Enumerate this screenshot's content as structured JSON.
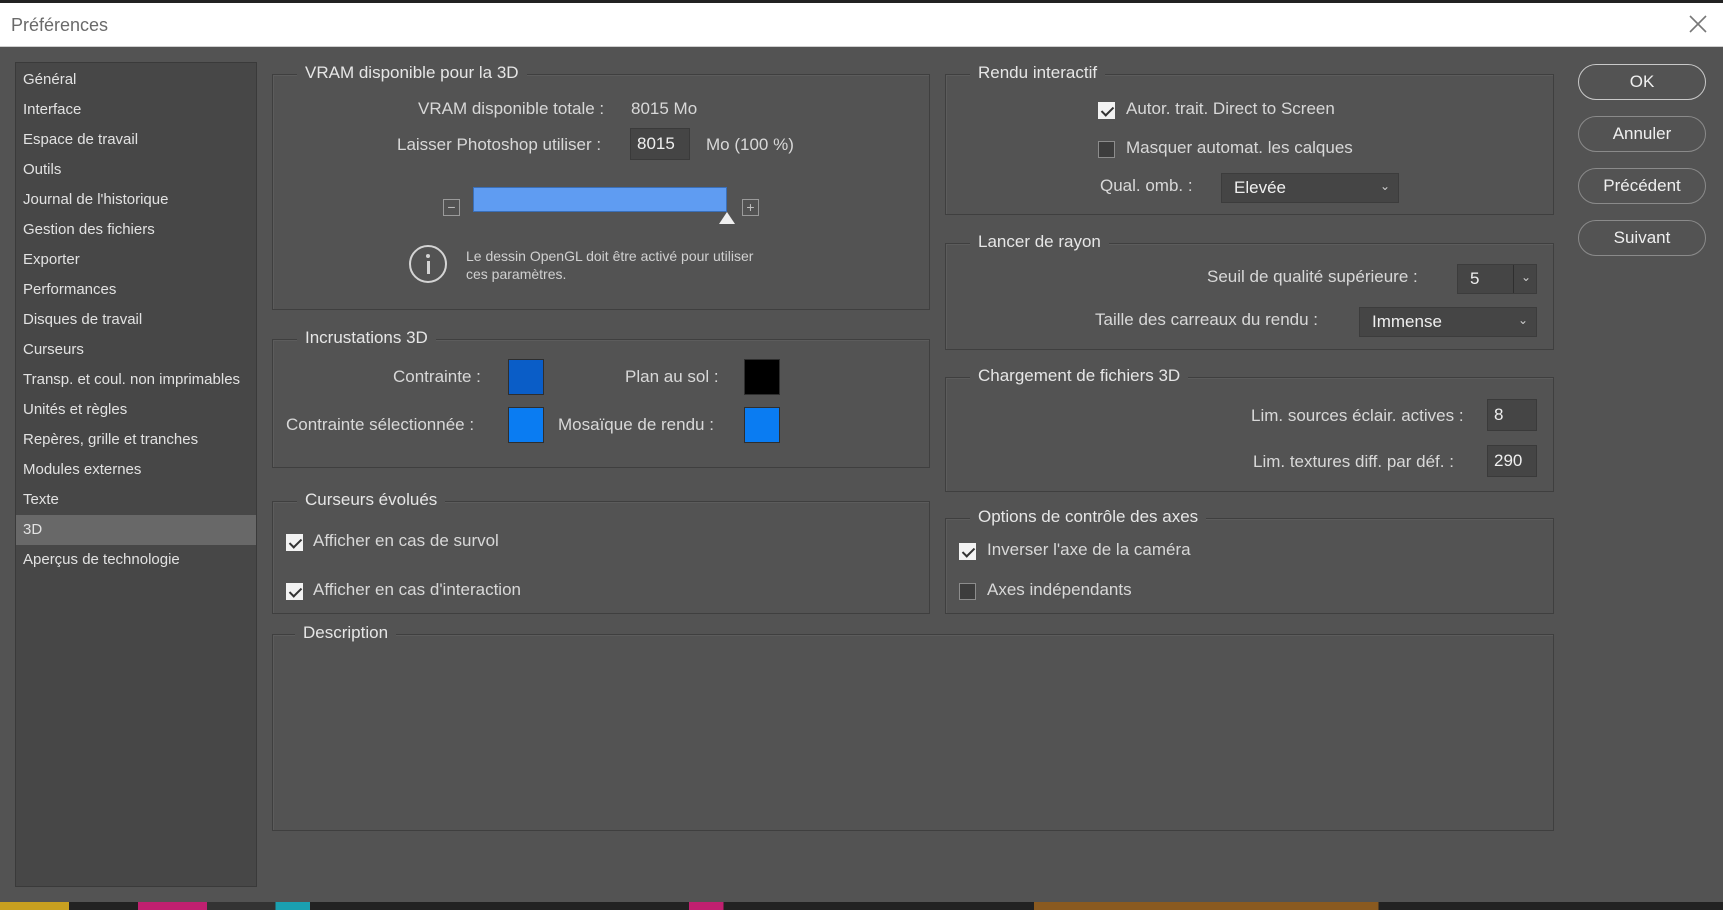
{
  "window": {
    "title": "Préférences",
    "close_icon": "close-icon"
  },
  "sidebar": {
    "items": [
      {
        "label": "Général"
      },
      {
        "label": "Interface"
      },
      {
        "label": "Espace de travail"
      },
      {
        "label": "Outils"
      },
      {
        "label": "Journal de l'historique"
      },
      {
        "label": "Gestion des fichiers"
      },
      {
        "label": "Exporter"
      },
      {
        "label": "Performances"
      },
      {
        "label": "Disques de travail"
      },
      {
        "label": "Curseurs"
      },
      {
        "label": "Transp. et coul. non imprimables"
      },
      {
        "label": "Unités et règles"
      },
      {
        "label": "Repères, grille et tranches"
      },
      {
        "label": "Modules externes"
      },
      {
        "label": "Texte"
      },
      {
        "label": "3D",
        "selected": true
      },
      {
        "label": "Aperçus de technologie"
      }
    ]
  },
  "vram": {
    "legend": "VRAM disponible pour la 3D",
    "total_label": "VRAM disponible totale :",
    "total_value": "8015 Mo",
    "use_label": "Laisser Photoshop utiliser :",
    "use_value": "8015",
    "use_unit": "Mo (100 %)",
    "slider_fraction": 1.0,
    "slider_color": "#5f9cf2",
    "minus_icon": "minus-box-icon",
    "plus_icon": "plus-box-icon",
    "info_icon": "info-circle-icon",
    "info_line1": "Le dessin OpenGL doit être activé pour utiliser",
    "info_line2": "ces paramètres."
  },
  "overlays": {
    "legend": "Incrustations 3D",
    "constraint_label": "Contrainte :",
    "constraint_color": "#0a5dc7",
    "ground_label": "Plan au sol :",
    "ground_color": "#000000",
    "selected_constraint_label": "Contrainte sélectionnée :",
    "selected_constraint_color": "#0a7cf2",
    "render_tile_label": "Mosaïque de rendu :",
    "render_tile_color": "#0a7cf2"
  },
  "cursors": {
    "legend": "Curseurs évolués",
    "hover_label": "Afficher en cas de survol",
    "hover_checked": true,
    "interaction_label": "Afficher en cas d'interaction",
    "interaction_checked": true
  },
  "interactive": {
    "legend": "Rendu interactif",
    "direct_label": "Autor. trait. Direct to Screen",
    "direct_checked": true,
    "hide_label": "Masquer automat. les calques",
    "hide_checked": false,
    "shadow_label": "Qual. omb. :",
    "shadow_value": "Elevée"
  },
  "raytrace": {
    "legend": "Lancer de rayon",
    "threshold_label": "Seuil de qualité supérieure :",
    "threshold_value": "5",
    "tile_label": "Taille des carreaux du rendu :",
    "tile_value": "Immense"
  },
  "fileload": {
    "legend": "Chargement de fichiers 3D",
    "lights_label": "Lim. sources éclair. actives :",
    "lights_value": "8",
    "textures_label": "Lim. textures diff. par déf. :",
    "textures_value": "290"
  },
  "axes": {
    "legend": "Options de contrôle des axes",
    "invert_label": "Inverser l'axe de la caméra",
    "invert_checked": true,
    "independent_label": "Axes indépendants",
    "independent_checked": false
  },
  "description": {
    "legend": "Description"
  },
  "buttons": {
    "ok": "OK",
    "cancel": "Annuler",
    "prev": "Précédent",
    "next": "Suivant"
  },
  "colors": {
    "dialog_bg": "#535353",
    "sidebar_bg": "#474747",
    "selected_item": "#686868"
  }
}
